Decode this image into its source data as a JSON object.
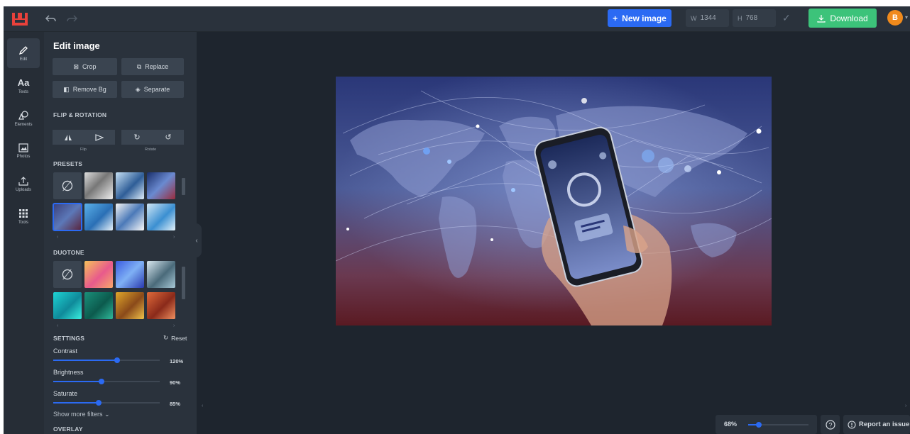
{
  "toolbar": {
    "new_image_label": "New image",
    "width_prefix": "W",
    "width_value": "1344",
    "height_prefix": "H",
    "height_value": "768",
    "download_label": "Download",
    "avatar_letter": "B"
  },
  "rail": {
    "items": [
      {
        "label": "Edit",
        "icon": "pencil-icon",
        "active": true
      },
      {
        "label": "Texts",
        "icon": "text-icon"
      },
      {
        "label": "Elements",
        "icon": "shapes-icon"
      },
      {
        "label": "Photos",
        "icon": "photo-icon"
      },
      {
        "label": "Uploads",
        "icon": "upload-icon"
      },
      {
        "label": "Tools",
        "icon": "grid-icon"
      }
    ]
  },
  "panel": {
    "title": "Edit image",
    "buttons": {
      "crop": "Crop",
      "replace": "Replace",
      "remove_bg": "Remove Bg",
      "separate": "Separate"
    },
    "flip_rotation_title": "FLIP & ROTATION",
    "flip_caption": "Flip",
    "rotate_caption": "Rotate",
    "presets_title": "PRESETS",
    "duotone_title": "DUOTONE",
    "settings_title": "SETTINGS",
    "reset_label": "Reset",
    "settings": [
      {
        "label": "Contrast",
        "value": "120%",
        "level": 0.6
      },
      {
        "label": "Brightness",
        "value": "90%",
        "level": 0.45
      },
      {
        "label": "Saturate",
        "value": "85%",
        "level": 0.425
      }
    ],
    "show_more_filters": "Show more filters",
    "overlay_title": "OVERLAY"
  },
  "zoom": {
    "value": "68%",
    "level": 0.18
  },
  "report_label": "Report an issue",
  "colors": {
    "accent": "#2b6af3",
    "download": "#3cc37a",
    "avatar": "#f08a1c",
    "logo": "#e8413b"
  }
}
